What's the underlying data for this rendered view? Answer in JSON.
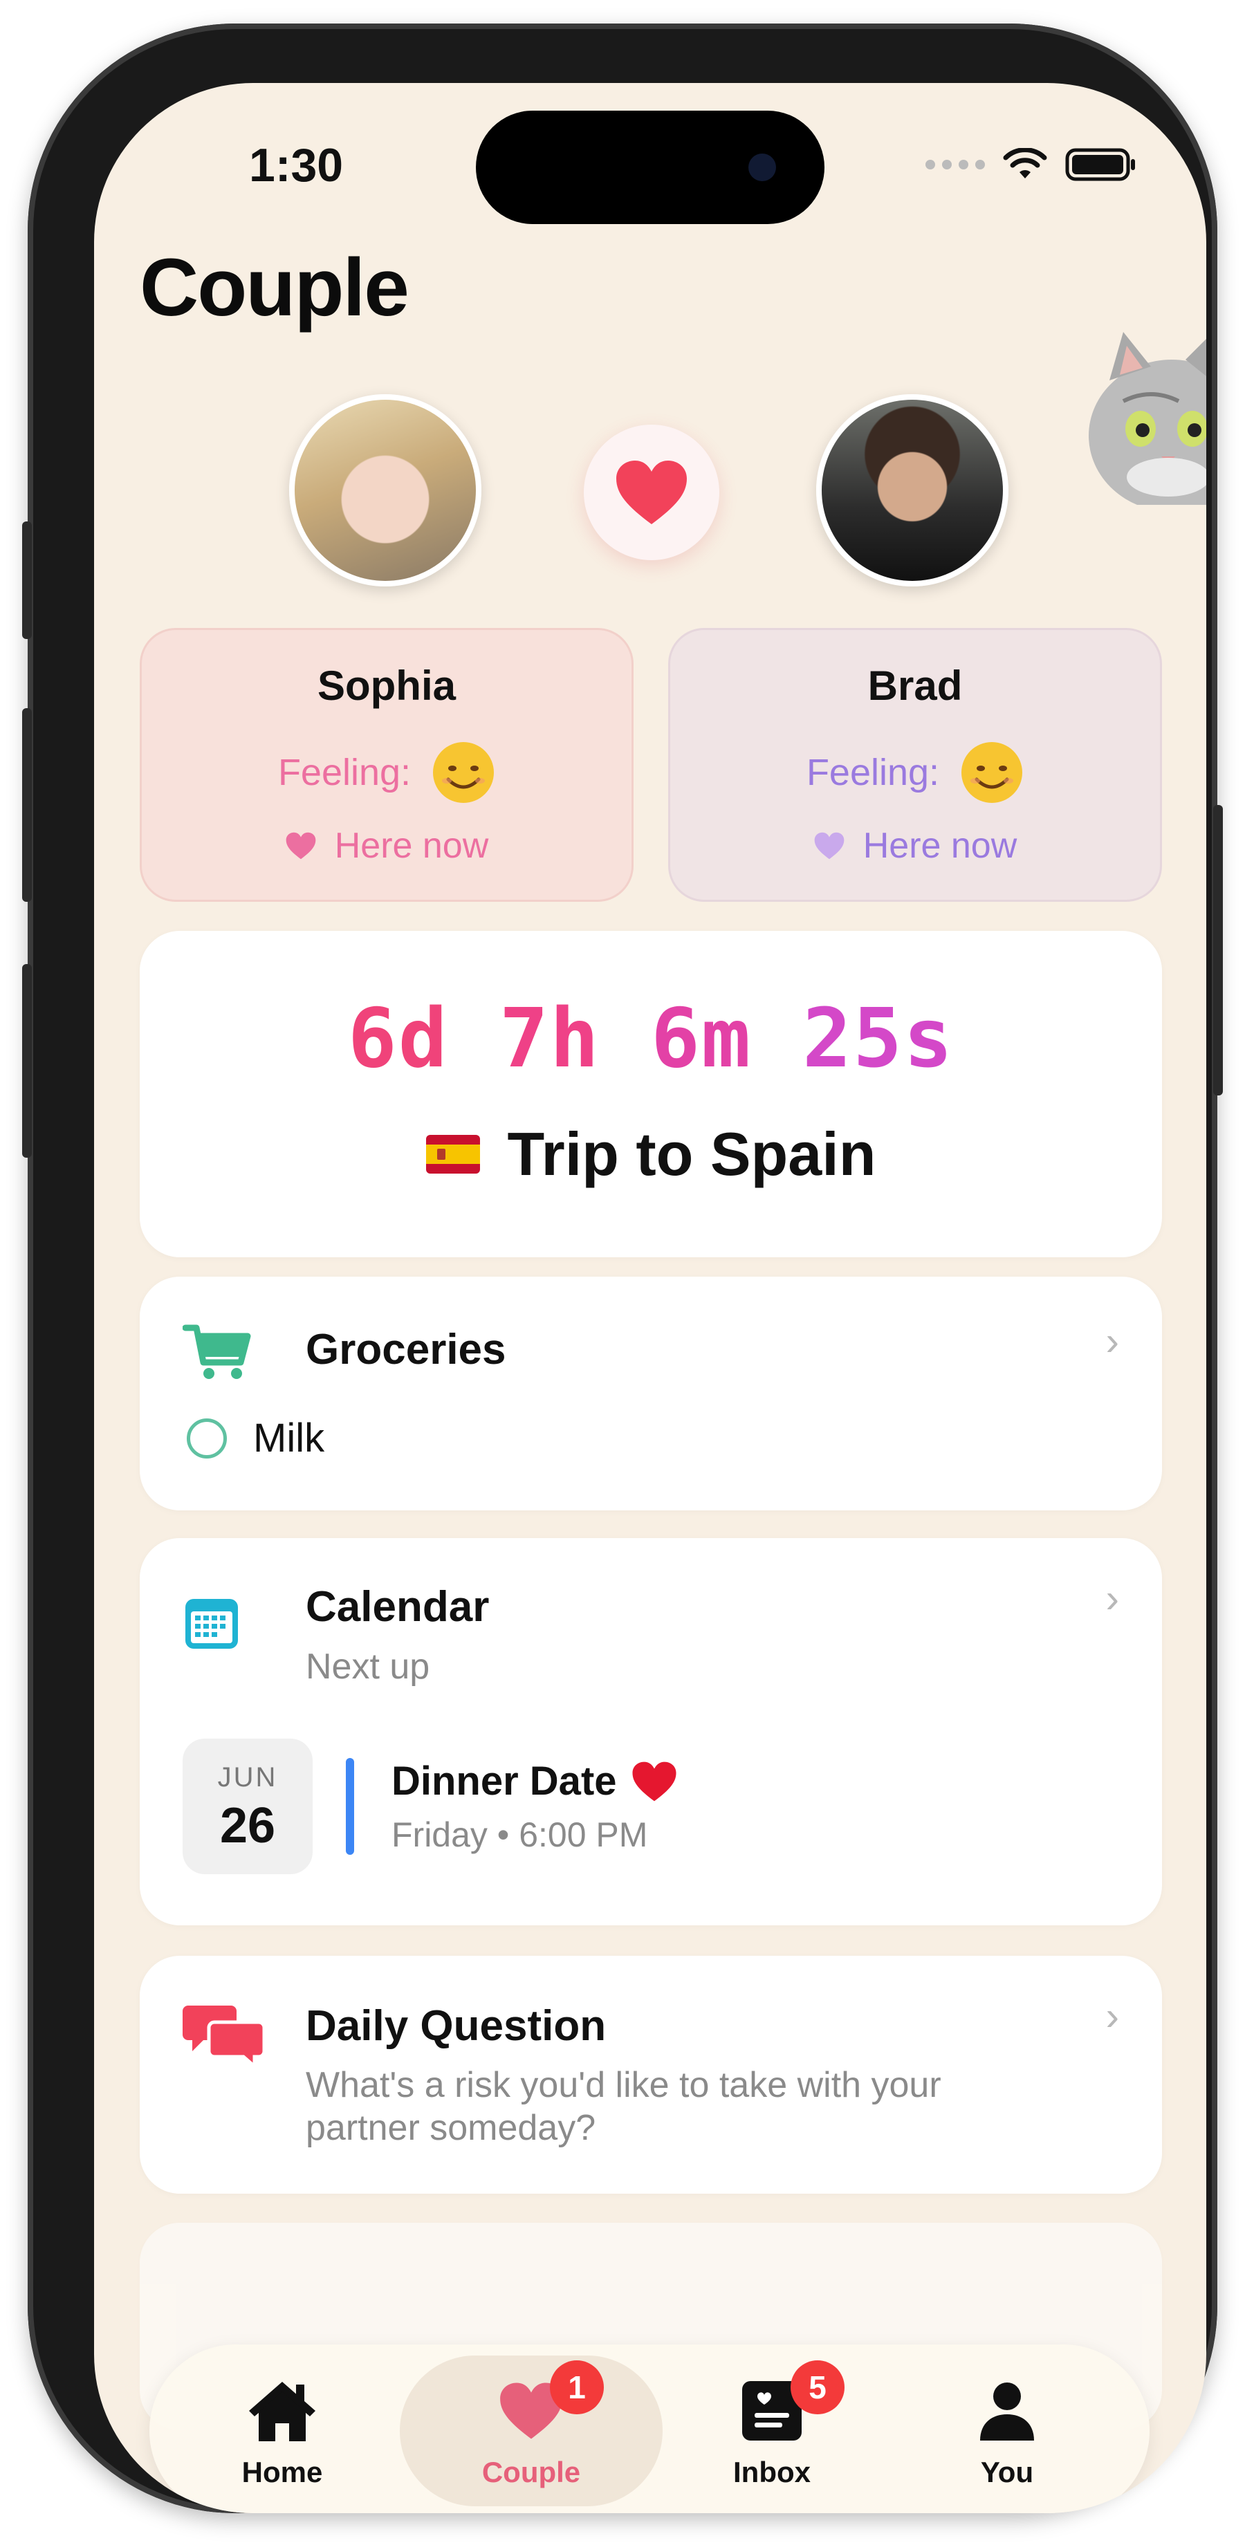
{
  "status": {
    "time": "1:30"
  },
  "page": {
    "title": "Couple"
  },
  "partners": [
    {
      "name": "Sophia",
      "feeling_label": "Feeling:",
      "feeling_emoji": "smiling-face",
      "presence": "Here now",
      "accent": "#ec6fa0"
    },
    {
      "name": "Brad",
      "feeling_label": "Feeling:",
      "feeling_emoji": "smiling-face",
      "presence": "Here now",
      "accent": "#9a7adf"
    }
  ],
  "countdown": {
    "days": "6d",
    "hours": "7h",
    "minutes": "6m",
    "seconds": "25s",
    "flag": "spain-flag",
    "label": "Trip to Spain"
  },
  "groceries": {
    "title": "Groceries",
    "items": [
      {
        "label": "Milk",
        "checked": false
      }
    ]
  },
  "calendar": {
    "title": "Calendar",
    "subtitle": "Next up",
    "event": {
      "month": "JUN",
      "day": "26",
      "title": "Dinner Date",
      "emoji": "red-heart",
      "time": "Friday • 6:00 PM"
    }
  },
  "daily_question": {
    "title": "Daily Question",
    "question": "What's a risk you'd like to take with your partner someday?"
  },
  "tabs": [
    {
      "label": "Home",
      "icon": "house-icon",
      "badge": null,
      "active": false
    },
    {
      "label": "Couple",
      "icon": "heart-icon",
      "badge": "1",
      "active": true
    },
    {
      "label": "Inbox",
      "icon": "inbox-icon",
      "badge": "5",
      "active": false
    },
    {
      "label": "You",
      "icon": "person-icon",
      "badge": null,
      "active": false
    }
  ],
  "colors": {
    "background": "#f8efe3",
    "heart": "#f2425a",
    "groceries_icon": "#3fb98d",
    "calendar_icon": "#1fb3d3",
    "question_icon": "#f2425a",
    "event_bar": "#3c86f5",
    "badge": "#f33a3a"
  }
}
